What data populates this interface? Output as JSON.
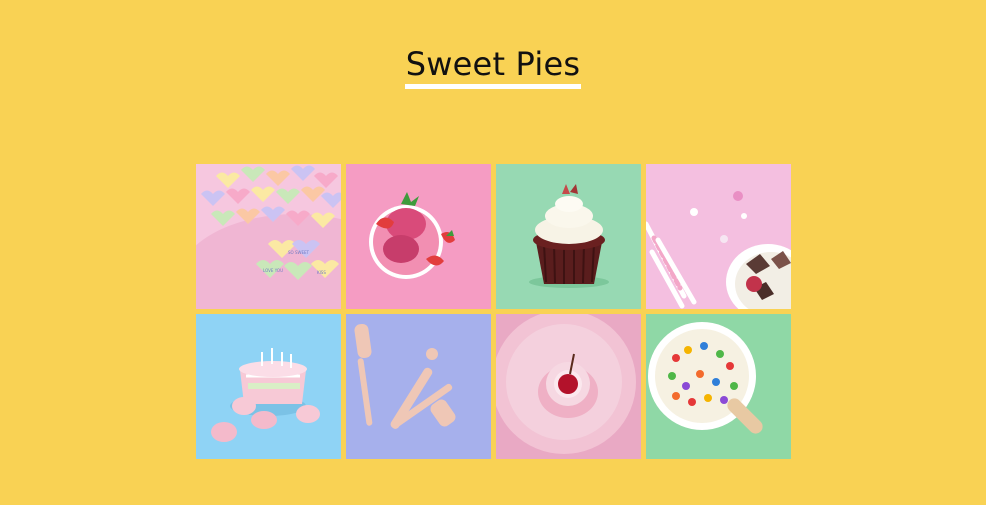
{
  "page": {
    "title": "Sweet Pies"
  },
  "gallery": {
    "images": [
      {
        "name": "candy-hearts",
        "bg": "#f3c3dc"
      },
      {
        "name": "strawberry-ice-cream",
        "bg": "#f59cc3"
      },
      {
        "name": "red-velvet-cupcake",
        "bg": "#97d9b3"
      },
      {
        "name": "meringues-straws",
        "bg": "#f4bfe0"
      },
      {
        "name": "slice-cake-candles",
        "bg": "#8fd3f5"
      },
      {
        "name": "baking-utensils",
        "bg": "#a6b0ec"
      },
      {
        "name": "cherry-cupcake-plate",
        "bg": "#e9a9c4"
      },
      {
        "name": "candy-ice-cream-bowl",
        "bg": "#8fd8a6"
      }
    ]
  },
  "candy_hearts": {
    "texts": [
      "LOVE YOU",
      "SO SWEET",
      "KISS"
    ]
  }
}
